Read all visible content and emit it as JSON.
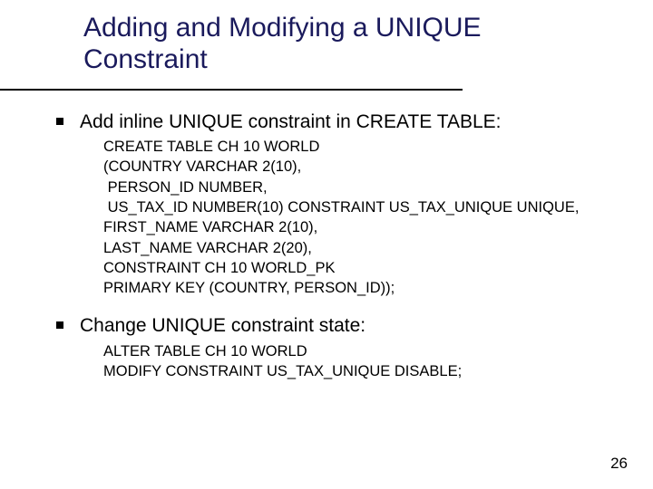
{
  "title": "Adding and Modifying a UNIQUE Constraint",
  "bullets": [
    {
      "text": "Add inline UNIQUE constraint in CREATE TABLE:",
      "code": [
        "CREATE TABLE CH 10 WORLD",
        "(COUNTRY VARCHAR 2(10),",
        " PERSON_ID NUMBER,",
        " US_TAX_ID NUMBER(10) CONSTRAINT US_TAX_UNIQUE UNIQUE,",
        "FIRST_NAME VARCHAR 2(10),",
        "LAST_NAME VARCHAR 2(20),",
        "CONSTRAINT CH 10 WORLD_PK",
        "PRIMARY KEY (COUNTRY, PERSON_ID));"
      ]
    },
    {
      "text": "Change UNIQUE constraint state:",
      "code": [
        "ALTER TABLE CH 10 WORLD",
        "MODIFY CONSTRAINT US_TAX_UNIQUE DISABLE;"
      ]
    }
  ],
  "page_number": "26"
}
